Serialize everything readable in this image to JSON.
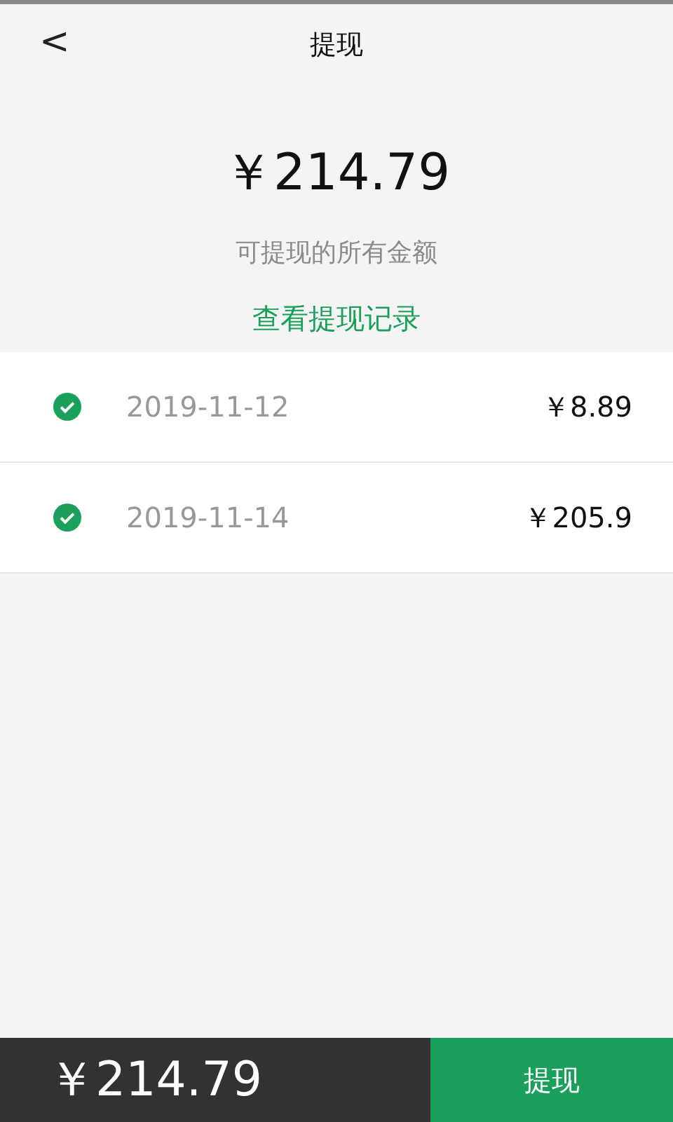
{
  "header": {
    "back": "<",
    "title": "提现"
  },
  "summary": {
    "amount": "￥214.79",
    "caption": "可提现的所有金额",
    "link": "查看提现记录"
  },
  "records": [
    {
      "date": "2019-11-12",
      "amount": "￥8.89",
      "checked": true
    },
    {
      "date": "2019-11-14",
      "amount": "￥205.9",
      "checked": true
    }
  ],
  "footer": {
    "total": "￥214.79",
    "button": "提现"
  }
}
